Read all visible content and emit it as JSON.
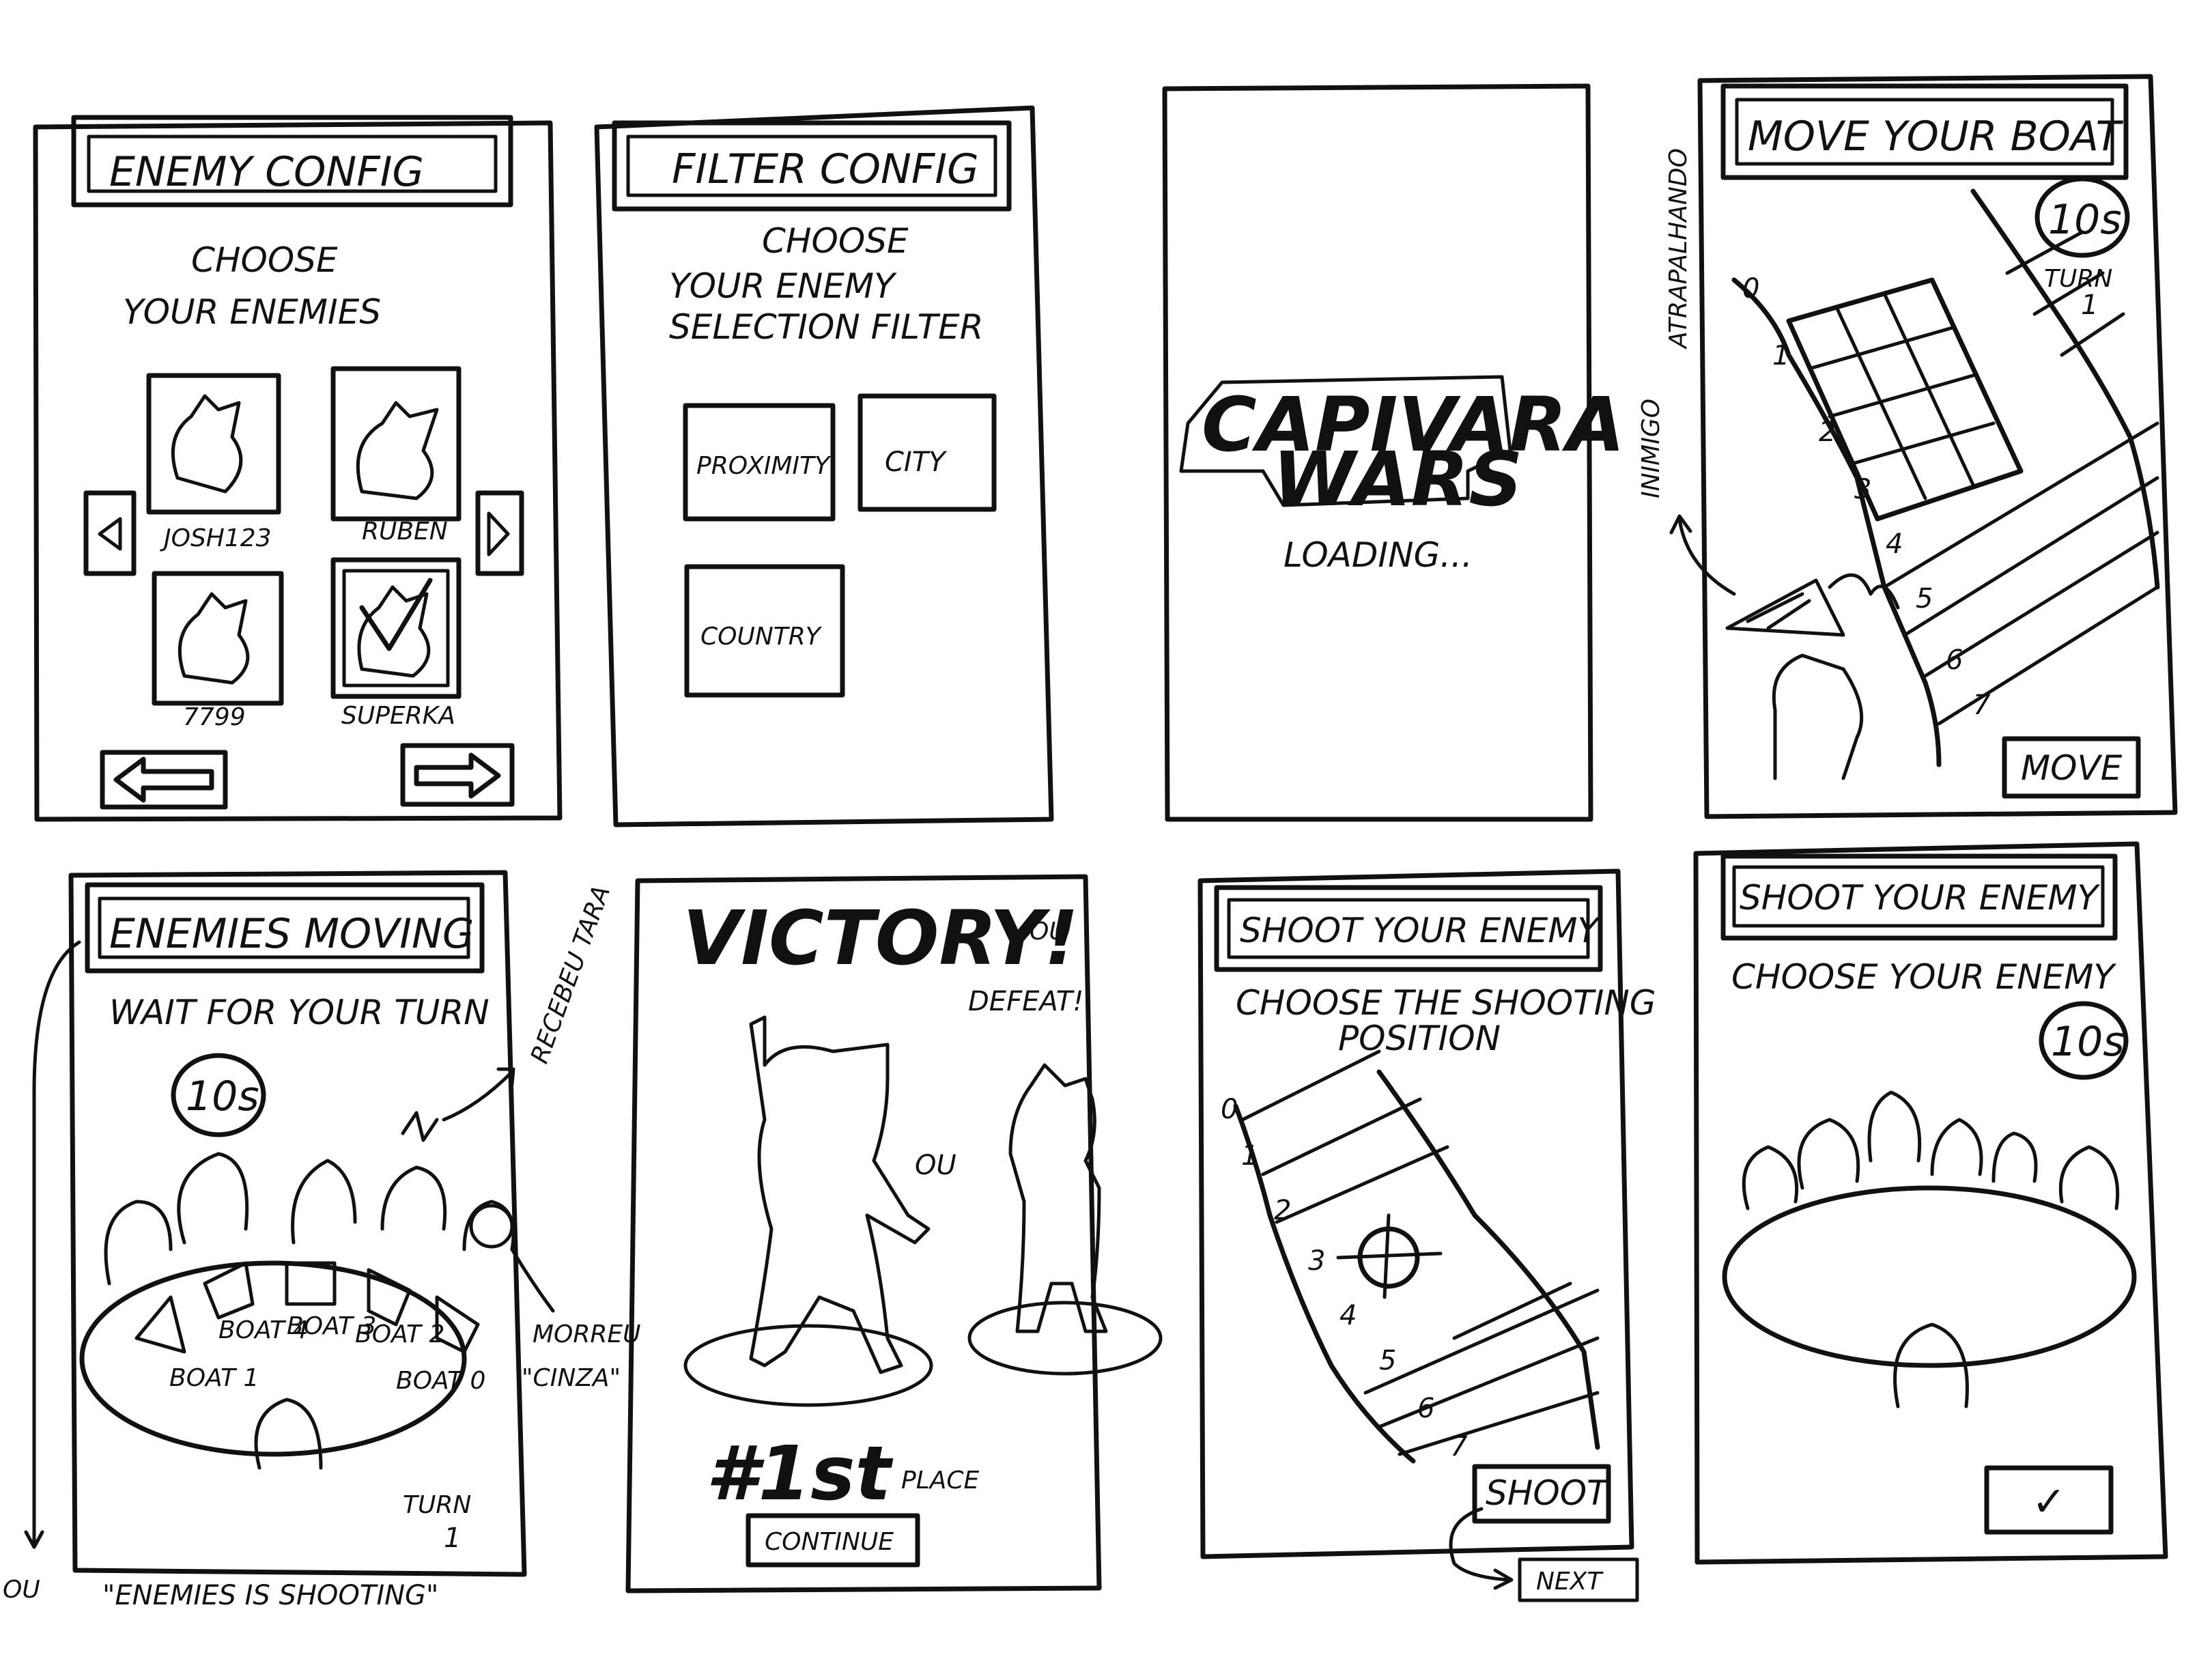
{
  "screens": {
    "enemy_config": {
      "title": "ENEMY CONFIG",
      "prompt_line1": "CHOOSE",
      "prompt_line2": "YOUR ENEMIES",
      "players": [
        "JOSH123",
        "RUBEN",
        "7799",
        "SUPERKA"
      ]
    },
    "filter_config": {
      "title": "FILTER CONFIG",
      "prompt_line1": "CHOOSE",
      "prompt_line2": "YOUR ENEMY",
      "prompt_line3": "SELECTION FILTER",
      "options": [
        "PROXIMITY",
        "CITY",
        "COUNTRY"
      ]
    },
    "loading": {
      "logo_line1": "CAPIVARA",
      "logo_line2": "WARS",
      "status": "LOADING..."
    },
    "move_boat": {
      "title": "MOVE YOUR BOAT",
      "timer": "10s",
      "turn_label": "TURN",
      "turn_number": "1",
      "lanes": [
        "0",
        "1",
        "2",
        "3",
        "4",
        "5",
        "6",
        "7"
      ],
      "move_button": "MOVE",
      "side_note_1": "INIMIGO",
      "side_note_2": "ATRAPALHANDO"
    },
    "enemies_moving": {
      "title": "ENEMIES MOVING",
      "subtitle": "WAIT FOR YOUR TURN",
      "timer": "10s",
      "boats": [
        "BOAT 1",
        "BOAT 4",
        "BOAT 3",
        "BOAT 2",
        "BOAT 0"
      ],
      "turn_label": "TURN",
      "turn_number": "1",
      "note_right": "RECEBEU TARA",
      "note_morreu": "MORREU",
      "note_cinza": "\"CINZA\"",
      "note_bottom": "\"ENEMIES IS SHOOTING\"",
      "note_left": "OU"
    },
    "victory": {
      "title": "VICTORY!",
      "or_small": "OU",
      "defeat": "DEFEAT!",
      "or_middle": "OU",
      "rank": "#1st",
      "place": "PLACE",
      "continue_button": "CONTINUE"
    },
    "shoot_position": {
      "title": "SHOOT YOUR ENEMY",
      "prompt_line1": "CHOOSE THE SHOOTING",
      "prompt_line2": "POSITION",
      "lanes": [
        "0",
        "1",
        "2",
        "3",
        "4",
        "5",
        "6",
        "7"
      ],
      "shoot_button": "SHOOT",
      "next_label": "NEXT"
    },
    "shoot_enemy": {
      "title": "SHOOT YOUR ENEMY",
      "prompt": "CHOOSE YOUR ENEMY",
      "timer": "10s",
      "confirm_mark": "✓"
    }
  }
}
